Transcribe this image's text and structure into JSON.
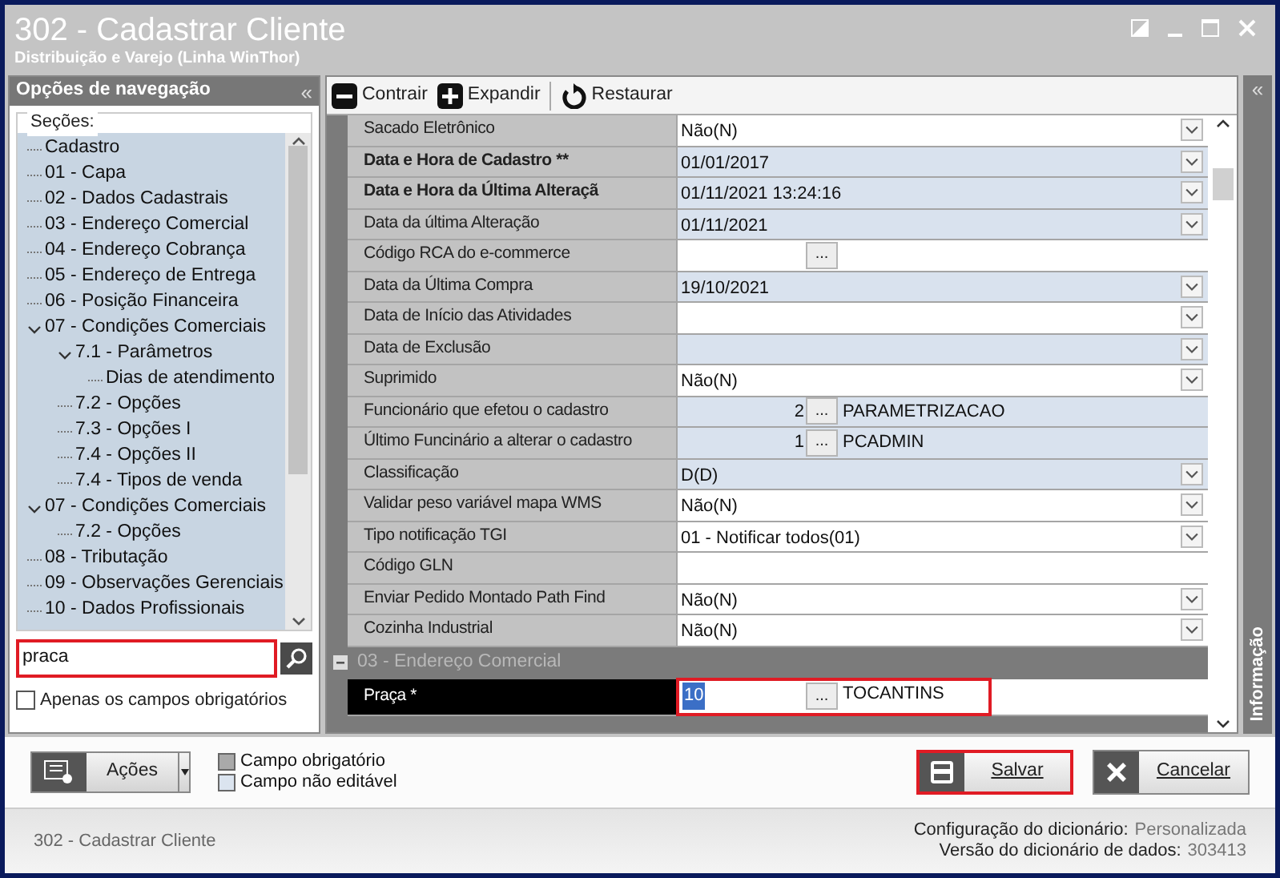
{
  "window": {
    "title": "302 - Cadastrar Cliente",
    "subtitle": "Distribuição e Varejo (Linha WinThor)"
  },
  "nav": {
    "title": "Opções de navegação",
    "collapse": "«",
    "sections_label": "Seções:",
    "tree": [
      {
        "label": "Cadastro"
      },
      {
        "label": "01 - Capa"
      },
      {
        "label": "02 - Dados Cadastrais"
      },
      {
        "label": "03 - Endereço Comercial"
      },
      {
        "label": "04 - Endereço Cobrança"
      },
      {
        "label": "05 - Endereço de Entrega"
      },
      {
        "label": "06 - Posição Financeira"
      },
      {
        "label": "07 - Condições Comerciais",
        "expanded": true,
        "children": [
          {
            "label": "7.1 - Parâmetros",
            "expanded": true,
            "children": [
              {
                "label": "Dias de atendimento"
              }
            ]
          },
          {
            "label": "7.2 - Opções"
          },
          {
            "label": "7.3 - Opções I"
          },
          {
            "label": "7.4 - Opções II"
          },
          {
            "label": "7.4 - Tipos de venda"
          }
        ]
      },
      {
        "label": "07 - Condições Comerciais",
        "expanded": true,
        "children": [
          {
            "label": "7.2 - Opções"
          }
        ]
      },
      {
        "label": "08 - Tributação"
      },
      {
        "label": "09 - Observações Gerenciais"
      },
      {
        "label": "10 - Dados Profissionais"
      }
    ],
    "search": {
      "value": "praca",
      "highlighted": true
    },
    "only_required": {
      "label": "Apenas os campos obrigatórios",
      "checked": false
    }
  },
  "toolbar": [
    {
      "label": "Contrair",
      "kind": "minus"
    },
    {
      "label": "Expandir",
      "kind": "plus"
    },
    {
      "label": "Restaurar",
      "kind": "restore"
    }
  ],
  "side_panel": {
    "collapse": "«",
    "label": "Informação"
  },
  "grid": {
    "rows": [
      {
        "kind": "dropdown",
        "label": "Sacado Eletrônico",
        "value": "Não(N)",
        "editable": true,
        "bold": false
      },
      {
        "kind": "dropdown",
        "label": "Data e Hora de Cadastro **",
        "value": "01/01/2017",
        "editable": false,
        "bold": true
      },
      {
        "kind": "dropdown",
        "label": "Data e Hora da Última Alteraçã",
        "value": "01/11/2021 13:24:16",
        "editable": false,
        "bold": true
      },
      {
        "kind": "dropdown",
        "label": "Data da última Alteração",
        "value": "01/11/2021",
        "editable": false,
        "bold": false
      },
      {
        "kind": "lookup",
        "label": "Código RCA do e-commerce",
        "button": "...",
        "editable": true,
        "bold": false
      },
      {
        "kind": "dropdown",
        "label": "Data da Última Compra",
        "value": "19/10/2021",
        "editable": false,
        "bold": false
      },
      {
        "kind": "dropdown",
        "label": "Data de Início das Atividades",
        "editable": true,
        "bold": false
      },
      {
        "kind": "dropdown",
        "label": "Data de Exclusão",
        "editable": false,
        "bold": false
      },
      {
        "kind": "dropdown",
        "label": "Suprimido",
        "value": "Não(N)",
        "editable": true,
        "bold": false
      },
      {
        "kind": "lookup",
        "label": "Funcionário que efetou o cadastro",
        "code": "2",
        "button": "...",
        "description": "PARAMETRIZACAO",
        "editable": false,
        "bold": false
      },
      {
        "kind": "lookup",
        "label": "Último Funcinário a alterar o cadastro",
        "code": "1",
        "button": "...",
        "description": "PCADMIN",
        "editable": false,
        "bold": false
      },
      {
        "kind": "dropdown",
        "label": "Classificação",
        "value": "D(D)",
        "editable": false,
        "bold": false
      },
      {
        "kind": "dropdown",
        "label": "Validar peso variável mapa WMS",
        "value": "Não(N)",
        "editable": true,
        "bold": false
      },
      {
        "kind": "dropdown",
        "label": "Tipo notificação TGI",
        "value": "01 - Notificar todos(01)",
        "editable": true,
        "bold": false
      },
      {
        "kind": "text",
        "label": "Código GLN",
        "editable": true,
        "bold": false
      },
      {
        "kind": "dropdown",
        "label": "Enviar Pedido Montado Path Find",
        "value": "Não(N)",
        "editable": true,
        "bold": false
      },
      {
        "kind": "dropdown",
        "label": "Cozinha Industrial",
        "value": "Não(N)",
        "editable": true,
        "bold": false
      },
      {
        "kind": "group",
        "label": "03 - Endereço Comercial",
        "expanded": true
      },
      {
        "kind": "lookup",
        "label": "Praça *",
        "code": "10",
        "button": "...",
        "description": "TOCANTINS",
        "editable": true,
        "bold": false,
        "selected": true,
        "highlighted": true
      }
    ]
  },
  "actions": {
    "label": "Ações"
  },
  "legend": [
    {
      "label": "Campo obrigatório",
      "color": "#a9a9a9"
    },
    {
      "label": "Campo não editável",
      "color": "#dbe4ef"
    }
  ],
  "buttons": [
    {
      "label": "Salvar",
      "kind": "save",
      "highlighted": true
    },
    {
      "label": "Cancelar",
      "kind": "cancel",
      "highlighted": false
    }
  ],
  "status_bar": {
    "left": "302 - Cadastrar Cliente",
    "items": [
      {
        "label": "Configuração do dicionário:",
        "value": "Personalizada"
      },
      {
        "label": "Versão do dicionário de dados:",
        "value": "303413"
      }
    ]
  }
}
